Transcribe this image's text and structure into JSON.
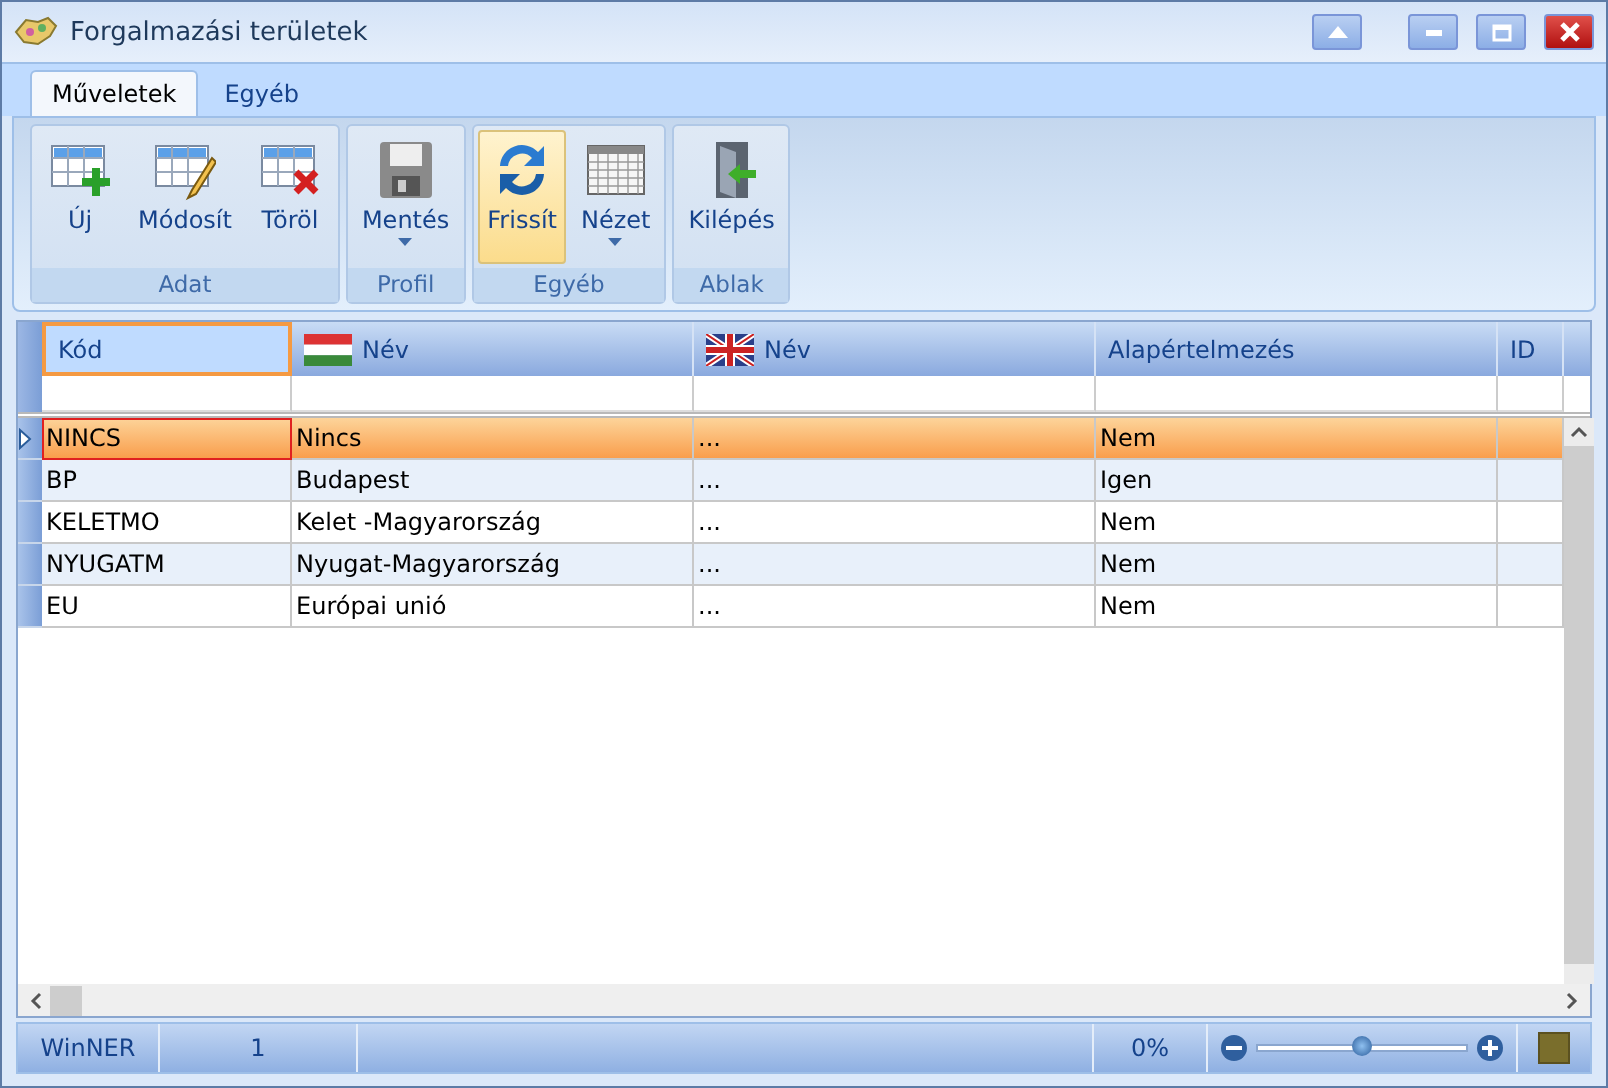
{
  "window": {
    "title": "Forgalmazási területek"
  },
  "tabs": [
    {
      "label": "Műveletek",
      "selected": true
    },
    {
      "label": "Egyéb",
      "selected": false
    }
  ],
  "ribbon_groups": [
    {
      "label": "Adat",
      "buttons": [
        {
          "label": "Új",
          "kind": "add",
          "dropdown": false,
          "active": false
        },
        {
          "label": "Módosít",
          "kind": "edit",
          "dropdown": false,
          "active": false
        },
        {
          "label": "Töröl",
          "kind": "delete",
          "dropdown": false,
          "active": false
        }
      ]
    },
    {
      "label": "Profil",
      "buttons": [
        {
          "label": "Mentés",
          "kind": "save",
          "dropdown": true,
          "active": false
        }
      ]
    },
    {
      "label": "Egyéb",
      "buttons": [
        {
          "label": "Frissít",
          "kind": "refresh",
          "dropdown": false,
          "active": true
        },
        {
          "label": "Nézet",
          "kind": "view",
          "dropdown": true,
          "active": false
        }
      ]
    },
    {
      "label": "Ablak",
      "buttons": [
        {
          "label": "Kilépés",
          "kind": "exit",
          "dropdown": false,
          "active": false
        }
      ]
    }
  ],
  "table": {
    "columns": [
      {
        "label": "Kód",
        "kind": "plain",
        "selected": true
      },
      {
        "label": "Név",
        "kind": "hungarian",
        "selected": false
      },
      {
        "label": "Név",
        "kind": "english",
        "selected": false
      },
      {
        "label": "Alapértelmezés",
        "kind": "plain",
        "selected": false
      },
      {
        "label": "ID",
        "kind": "plain",
        "selected": false
      }
    ],
    "rows": [
      {
        "cells": [
          "NINCS",
          "Nincs",
          "...",
          "Nem",
          ""
        ],
        "selected": true
      },
      {
        "cells": [
          "BP",
          "Budapest",
          "...",
          "Igen",
          ""
        ],
        "selected": false
      },
      {
        "cells": [
          "KELETMO",
          "Kelet -Magyarország",
          "...",
          "Nem",
          ""
        ],
        "selected": false
      },
      {
        "cells": [
          "NYUGATM",
          "Nyugat-Magyarország",
          "...",
          "Nem",
          ""
        ],
        "selected": false
      },
      {
        "cells": [
          "EU",
          "Európai unió",
          "...",
          "Nem",
          ""
        ],
        "selected": false
      }
    ]
  },
  "status_bar": {
    "app": "WinNER",
    "count": "1",
    "zoom_text": "0%",
    "zoom": {
      "level": 0.5
    }
  }
}
